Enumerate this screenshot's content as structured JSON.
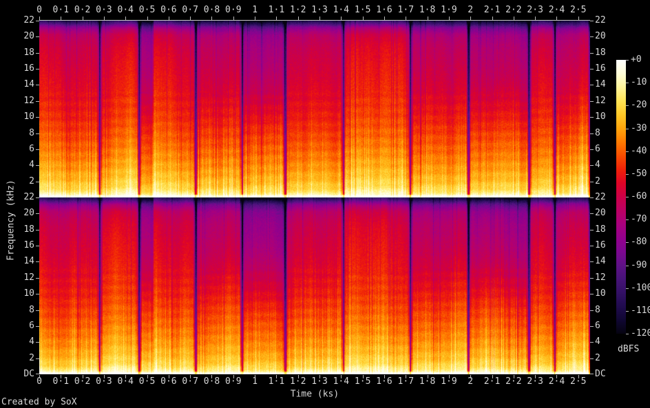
{
  "credit": "Created by SoX",
  "colors": {
    "background": "#000000",
    "text": "#d8d8d8",
    "axis": "#b8b8b8"
  },
  "chart_data": {
    "type": "heatmap",
    "subtype": "stereo-spectrogram",
    "title": "",
    "xlabel": "Time (ks)",
    "ylabel": "Frequency (kHz)",
    "colorbar_label": "dBFS",
    "channels": 2,
    "duration_ks": 2.555,
    "x_tick_step_ks": 0.1,
    "x_tick_labels": [
      "0",
      "0·1",
      "0·2",
      "0·3",
      "0·4",
      "0·5",
      "0·6",
      "0·7",
      "0·8",
      "0·9",
      "1",
      "1·1",
      "1·2",
      "1·3",
      "1·4",
      "1·5",
      "1·6",
      "1·7",
      "1·8",
      "1·9",
      "2",
      "2·1",
      "2·2",
      "2·3",
      "2·4",
      "2·5"
    ],
    "y_max_khz": 22,
    "y_tick_labels": [
      "22",
      "20",
      "18",
      "16",
      "14",
      "12",
      "10",
      "8",
      "6",
      "4",
      "2"
    ],
    "dc_label": "DC",
    "colorbar_range_db": [
      0,
      -120
    ],
    "colorbar_tick_labels": [
      "+0",
      "-10",
      "-20",
      "-30",
      "-40",
      "-50",
      "-60",
      "-70",
      "-80",
      "-90",
      "-100",
      "-110",
      "-120"
    ],
    "palette_stops": [
      {
        "db": 0,
        "color": "#ffffff"
      },
      {
        "db": -6,
        "color": "#fffdd8"
      },
      {
        "db": -12,
        "color": "#fff49a"
      },
      {
        "db": -18,
        "color": "#ffe355"
      },
      {
        "db": -24,
        "color": "#ffc827"
      },
      {
        "db": -30,
        "color": "#ffa50c"
      },
      {
        "db": -36,
        "color": "#ff7a00"
      },
      {
        "db": -42,
        "color": "#f94d00"
      },
      {
        "db": -48,
        "color": "#f02108"
      },
      {
        "db": -54,
        "color": "#e00426"
      },
      {
        "db": -60,
        "color": "#cc0047"
      },
      {
        "db": -66,
        "color": "#bb0063"
      },
      {
        "db": -72,
        "color": "#a9007d"
      },
      {
        "db": -78,
        "color": "#94008c"
      },
      {
        "db": -84,
        "color": "#7d0790"
      },
      {
        "db": -90,
        "color": "#5f1187"
      },
      {
        "db": -96,
        "color": "#471378"
      },
      {
        "db": -102,
        "color": "#331065"
      },
      {
        "db": -108,
        "color": "#200b4e"
      },
      {
        "db": -114,
        "color": "#100732"
      },
      {
        "db": -120,
        "color": "#050310"
      }
    ],
    "freq_profile_db": [
      [
        0.0,
        -4
      ],
      [
        0.01,
        -7
      ],
      [
        0.025,
        -14
      ],
      [
        0.05,
        -20
      ],
      [
        0.09,
        -25
      ],
      [
        0.15,
        -30
      ],
      [
        0.22,
        -35
      ],
      [
        0.32,
        -41
      ],
      [
        0.45,
        -47
      ],
      [
        0.6,
        -51
      ],
      [
        0.75,
        -54
      ],
      [
        0.85,
        -57
      ],
      [
        0.92,
        -62
      ],
      [
        0.955,
        -72
      ],
      [
        0.98,
        -84
      ],
      [
        1.0,
        -94
      ]
    ],
    "segments_ks": [
      {
        "start": 0.0,
        "end": 0.28,
        "level": 0,
        "hi": -2,
        "gap_before": false
      },
      {
        "start": 0.28,
        "end": 0.462,
        "level": 1,
        "hi": 0,
        "gap_before": true
      },
      {
        "start": 0.462,
        "end": 0.53,
        "level": -5,
        "hi": -12,
        "gap_before": true
      },
      {
        "start": 0.53,
        "end": 0.725,
        "level": 1,
        "hi": -1,
        "gap_before": false
      },
      {
        "start": 0.725,
        "end": 0.94,
        "level": -1,
        "hi": -5,
        "hi2": -9,
        "gap_before": true
      },
      {
        "start": 0.94,
        "end": 1.14,
        "level": -4,
        "hi": -13,
        "hi2": -16,
        "gap_before": true
      },
      {
        "start": 1.14,
        "end": 1.41,
        "level": 0,
        "hi": -3,
        "gap_before": true
      },
      {
        "start": 1.41,
        "end": 1.72,
        "level": 2,
        "hi": 0,
        "gap_before": true
      },
      {
        "start": 1.72,
        "end": 1.99,
        "level": 0,
        "hi": -6,
        "hi2": -9,
        "gap_before": true
      },
      {
        "start": 1.99,
        "end": 2.27,
        "level": -2,
        "hi": -11,
        "hi2": -13,
        "gap_before": true
      },
      {
        "start": 2.27,
        "end": 2.39,
        "level": 1,
        "hi": -2,
        "gap_before": true
      },
      {
        "start": 2.39,
        "end": 2.555,
        "level": 0,
        "hi": -6,
        "boost": true,
        "gap_before": true
      }
    ]
  }
}
